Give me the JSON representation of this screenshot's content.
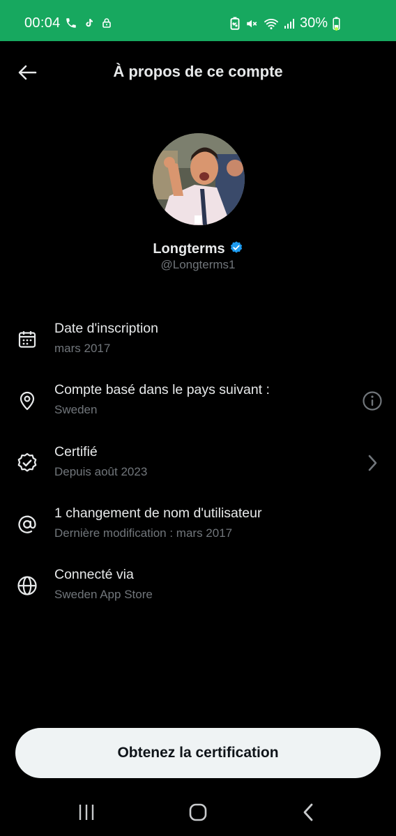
{
  "status_bar": {
    "time": "00:04",
    "battery": "30%",
    "left_icons": [
      "phone-icon",
      "tiktok-icon",
      "lock-icon"
    ],
    "right_icons": [
      "battery-saver-icon",
      "mute-icon",
      "wifi-icon",
      "signal-icon",
      "battery-icon"
    ]
  },
  "header": {
    "title": "À propos de ce compte",
    "back_icon": "back-arrow-icon"
  },
  "profile": {
    "display_name": "Longterms",
    "handle": "@Longterms1",
    "verified": true,
    "verified_color": "#1d9bf0"
  },
  "info_items": [
    {
      "icon": "calendar-icon",
      "title": "Date d'inscription",
      "subtitle": "mars 2017"
    },
    {
      "icon": "location-pin-icon",
      "title": "Compte basé dans le pays suivant :",
      "subtitle": "Sweden",
      "action_icon": "info-icon"
    },
    {
      "icon": "verified-badge-icon",
      "title": "Certifié",
      "subtitle": "Depuis août 2023",
      "action_icon": "chevron-right-icon"
    },
    {
      "icon": "at-sign-icon",
      "title": "1 changement de nom d'utilisateur",
      "subtitle": "Dernière modification : mars 2017"
    },
    {
      "icon": "globe-icon",
      "title": "Connecté via",
      "subtitle": "Sweden App Store"
    }
  ],
  "cta": {
    "label": "Obtenez la certification"
  },
  "nav": {
    "icons": [
      "recent-apps-icon",
      "home-icon",
      "nav-back-icon"
    ]
  },
  "colors": {
    "status_bar": "#17a85f",
    "background": "#000000",
    "primary_text": "#e7e9ea",
    "secondary_text": "#71767b",
    "button_bg": "#eff3f4"
  }
}
